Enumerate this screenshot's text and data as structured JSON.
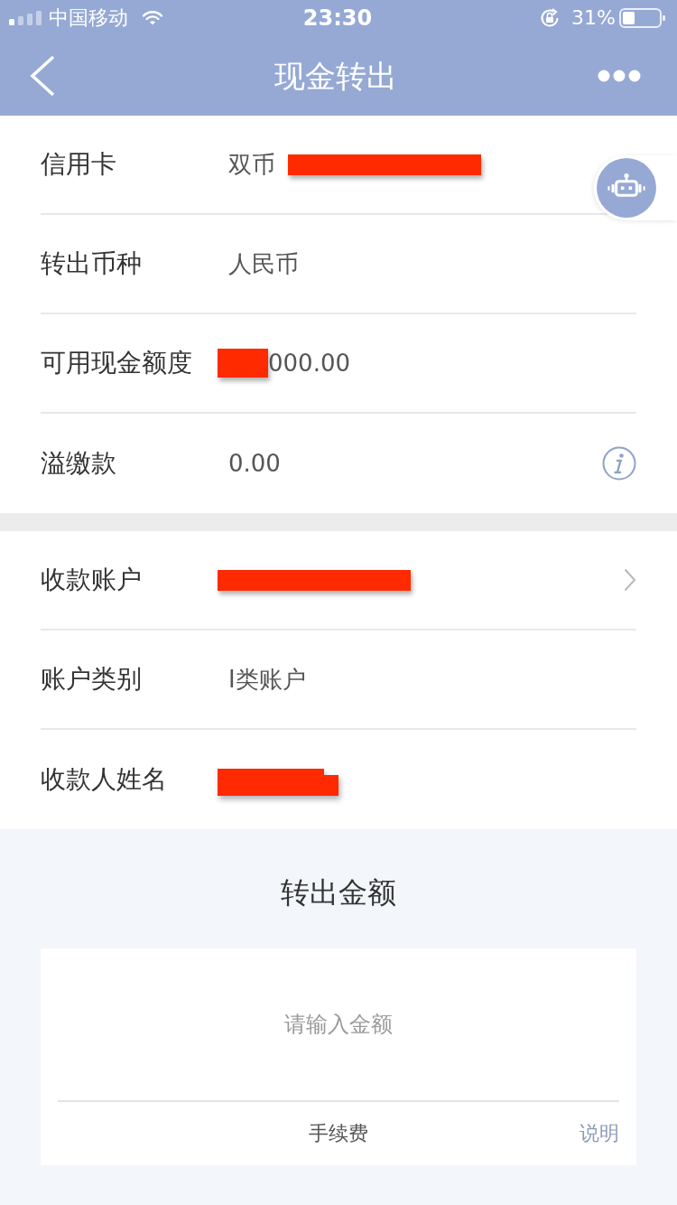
{
  "status_bar": {
    "carrier": "中国移动",
    "time": "23:30",
    "battery": "31%"
  },
  "nav": {
    "title": "现金转出"
  },
  "sections": [
    {
      "rows": [
        {
          "label": "信用卡",
          "value": [
            {
              "kind": "text",
              "text": "双币"
            },
            {
              "kind": "bar"
            }
          ],
          "chevron": false,
          "info": false
        },
        {
          "label": "转出币种",
          "value": [
            {
              "kind": "text",
              "text": "人民币"
            }
          ],
          "chevron": false,
          "info": false
        },
        {
          "label": "可用现金额度",
          "value": [
            {
              "kind": "block"
            },
            {
              "kind": "text",
              "text": "000.00"
            }
          ],
          "chevron": false,
          "info": false
        },
        {
          "label": "溢缴款",
          "value": [
            {
              "kind": "text",
              "text": "0.00"
            }
          ],
          "chevron": false,
          "info": true
        }
      ]
    },
    {
      "rows": [
        {
          "label": "收款账户",
          "value": [
            {
              "kind": "bar"
            }
          ],
          "chevron": true,
          "info": false
        },
        {
          "label": "账户类别",
          "value": [
            {
              "kind": "text",
              "text": "I类账户"
            }
          ],
          "chevron": false,
          "info": false
        },
        {
          "label": "收款人姓名",
          "value": [
            {
              "kind": "step"
            }
          ],
          "chevron": false,
          "info": false
        }
      ]
    }
  ],
  "amount": {
    "title": "转出金额",
    "placeholder": "请输入金额",
    "fee_label": "手续费",
    "fee_link": "说明"
  }
}
